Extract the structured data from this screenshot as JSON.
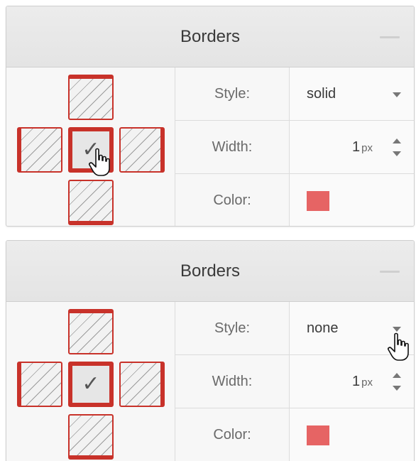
{
  "panels": [
    {
      "title": "Borders",
      "style": {
        "label": "Style:",
        "value": "solid"
      },
      "width": {
        "label": "Width:",
        "value": "1",
        "unit": "px"
      },
      "color": {
        "label": "Color:",
        "swatch": "#e66464"
      }
    },
    {
      "title": "Borders",
      "style": {
        "label": "Style:",
        "value": "none"
      },
      "width": {
        "label": "Width:",
        "value": "1",
        "unit": "px"
      },
      "color": {
        "label": "Color:",
        "swatch": "#e66464"
      }
    }
  ],
  "colors": {
    "border_accent": "#c8322a",
    "swatch": "#e66464"
  },
  "icons": [
    "collapse-icon",
    "check-icon",
    "caret-down-icon",
    "stepper-icon",
    "hand-cursor-icon"
  ]
}
